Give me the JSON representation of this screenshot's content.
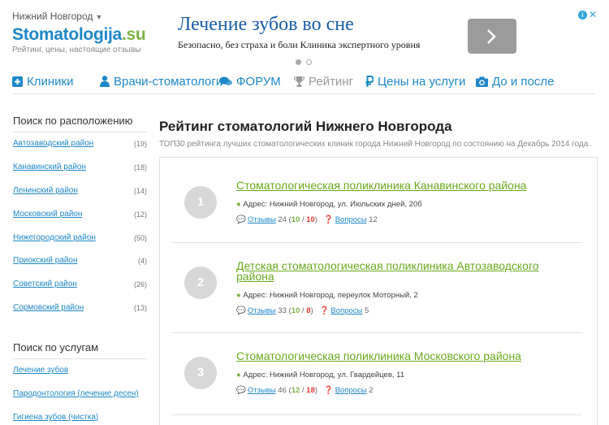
{
  "header": {
    "city": "Нижний Новгород",
    "logo_main": "Stomatologija",
    "logo_tld": ".su",
    "tagline": "Рейтинг, цены, настоящие отзывы"
  },
  "ad": {
    "title": "Лечение зубов во сне",
    "text": "Безопасно, без страха и боли Клиника экспертного уровня",
    "info_glyph": "i",
    "close_glyph": "✕"
  },
  "nav": {
    "items": [
      {
        "label": "Клиники",
        "icon": "plus-square-icon"
      },
      {
        "label": "Врачи-стоматологи",
        "icon": "user-md-icon"
      },
      {
        "label": "ФОРУМ",
        "icon": "comments-icon"
      },
      {
        "label": "Рейтинг",
        "icon": "trophy-icon"
      },
      {
        "label": "Цены на услуги",
        "icon": "ruble-icon"
      },
      {
        "label": "До и после",
        "icon": "camera-icon"
      }
    ]
  },
  "sidebar": {
    "location_title": "Поиск по расположению",
    "districts": [
      {
        "label": "Автозаводский район",
        "count": "(19)"
      },
      {
        "label": "Канавинский район",
        "count": "(18)"
      },
      {
        "label": "Ленинский район",
        "count": "(14)"
      },
      {
        "label": "Московский район",
        "count": "(12)"
      },
      {
        "label": "Нижегородский район",
        "count": "(50)"
      },
      {
        "label": "Приокский район",
        "count": "(4)"
      },
      {
        "label": "Советский район",
        "count": "(26)"
      },
      {
        "label": "Сормовский район",
        "count": "(13)"
      }
    ],
    "services_title": "Поиск по услугам",
    "services": [
      {
        "label": "Лечение зубов"
      },
      {
        "label": "Пародонтология (лечение десен)"
      },
      {
        "label": "Гигиена зубов (чистка)"
      }
    ]
  },
  "main": {
    "title": "Рейтинг стоматологий Нижнего Новгорода",
    "subtitle": "ТОП30 рейтинга лучших стоматологических клиник города Нижний Новгород по состоянию на Декабрь 2014 года.",
    "clinics": [
      {
        "rank": "1",
        "name": "Стоматологическая поликлиника Канавинского района",
        "address": "Адрес: Нижний Новгород, ул. Июльских дней, 20б",
        "reviews_label": "Отзывы",
        "reviews_total": "24",
        "reviews_good": "10",
        "reviews_bad": "10",
        "questions_label": "Вопросы",
        "questions": "12"
      },
      {
        "rank": "2",
        "name": "Детская стоматологическая поликлиника Автозаводского района",
        "address": "Адрес: Нижний Новгород, переулок Моторный, 2",
        "reviews_label": "Отзывы",
        "reviews_total": "33",
        "reviews_good": "10",
        "reviews_bad": "8",
        "questions_label": "Вопросы",
        "questions": "5"
      },
      {
        "rank": "3",
        "name": "Стоматологическая поликлиника Московского района",
        "address": "Адрес: Нижний Новгород, ул. Гвардейцев, 11",
        "reviews_label": "Отзывы",
        "reviews_total": "46",
        "reviews_good": "12",
        "reviews_bad": "18",
        "questions_label": "Вопросы",
        "questions": "2"
      }
    ]
  },
  "colors": {
    "brand_blue": "#1e88c8",
    "brand_green": "#7cb342",
    "negative_red": "#e53935"
  }
}
